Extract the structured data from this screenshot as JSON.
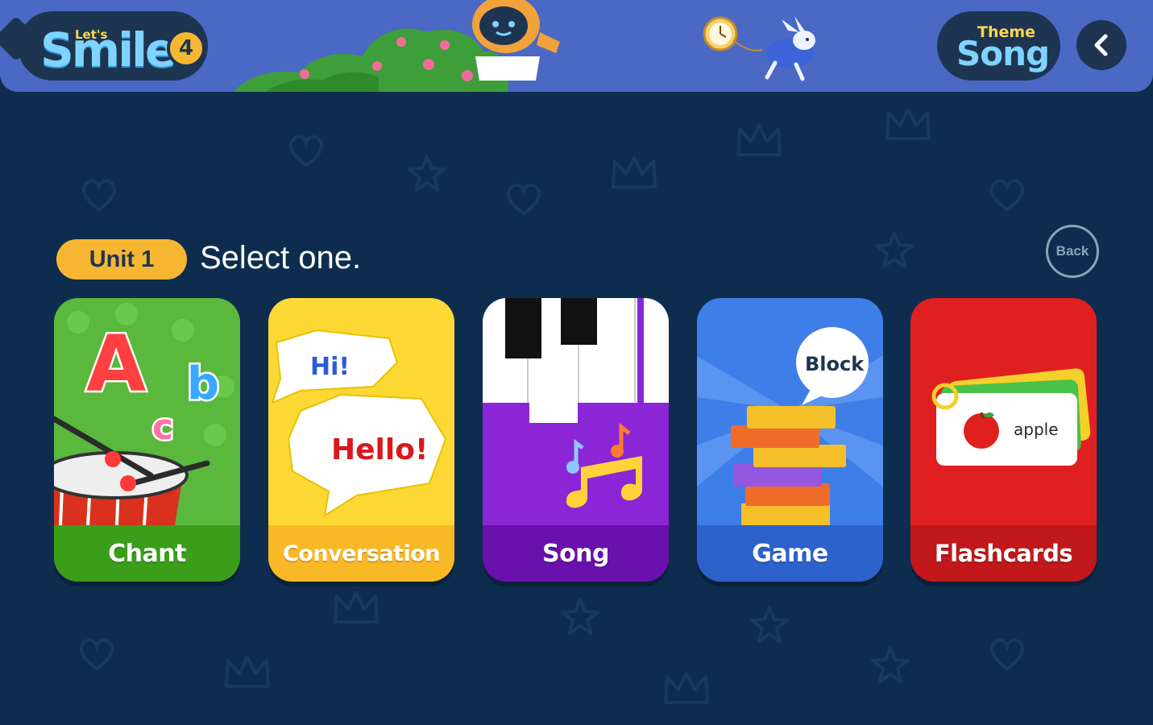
{
  "header": {
    "logo": {
      "lets": "Let's",
      "smile": "Smile",
      "level": "4"
    },
    "theme_song": {
      "top": "Theme",
      "bottom": "Song"
    },
    "nav_back_icon": "chevron-left-icon"
  },
  "unit": {
    "badge": "Unit 1",
    "prompt": "Select one.",
    "back_label": "Back"
  },
  "cards": [
    {
      "label": "Chant",
      "icon": "drum-abc-icon",
      "color": "#3a9e1a",
      "art_text": [
        "A",
        "b",
        "c"
      ]
    },
    {
      "label": "Conversation",
      "icon": "speech-bubbles-icon",
      "color": "#f9b825",
      "art_text": [
        "Hi!",
        "Hello!"
      ]
    },
    {
      "label": "Song",
      "icon": "piano-notes-icon",
      "color": "#6a10ad"
    },
    {
      "label": "Game",
      "icon": "block-tower-icon",
      "color": "#2d62cc",
      "art_text": [
        "Block"
      ]
    },
    {
      "label": "Flashcards",
      "icon": "flashcard-apple-icon",
      "color": "#c0181b",
      "art_text": [
        "apple"
      ]
    }
  ],
  "colors": {
    "background": "#0e2d4e",
    "header": "#4a68c4",
    "pill": "#1d3551",
    "accent": "#f7b632"
  }
}
